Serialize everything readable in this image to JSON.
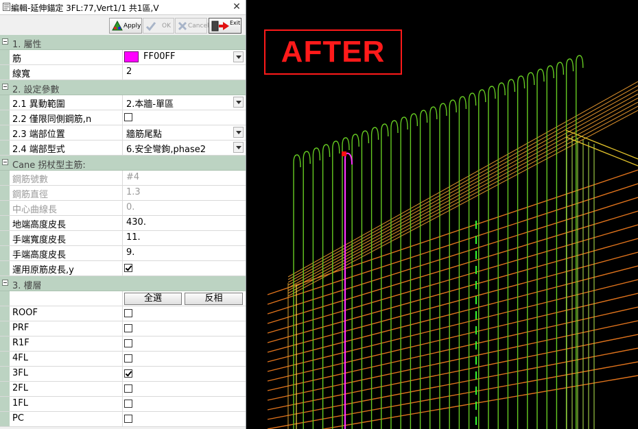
{
  "window": {
    "title": "編輯-延伸錨定 3FL:77,Vert1/1 共1區,V",
    "close_glyph": "✕"
  },
  "toolbar": {
    "apply": "Apply",
    "ok": "OK",
    "cancel": "Cancel",
    "exit": "Exit"
  },
  "sections": {
    "s1": "1. 屬性",
    "s2": "2. 設定參數",
    "s3": "Cane 拐杖型主筋:",
    "s4": "3. 樓層"
  },
  "props": {
    "rebar": {
      "name": "筋",
      "value": "FF00FF",
      "color": "#ff00ff"
    },
    "linewidth": {
      "name": "線寬",
      "value": "2"
    },
    "range": {
      "name": "2.1 異動範圍",
      "value": "2.本牆-單區"
    },
    "sameside": {
      "name": "2.2 僅限同側鋼筋,n",
      "checked": false
    },
    "endpos": {
      "name": "2.3 端部位置",
      "value": "牆筋尾點"
    },
    "endtype": {
      "name": "2.4 端部型式",
      "value": "6.安全彎鉤,phase2"
    },
    "barno": {
      "name": "鋼筋號數",
      "value": "#4"
    },
    "bardia": {
      "name": "鋼筋直徑",
      "value": "1.3"
    },
    "curve": {
      "name": "中心曲線長",
      "value": "0."
    },
    "ground": {
      "name": "地端高度皮長",
      "value": "430."
    },
    "handw": {
      "name": "手端寬度皮長",
      "value": "11."
    },
    "handh": {
      "name": "手端高度皮長",
      "value": "9."
    },
    "apply_orig": {
      "name": "運用原筋皮長,y",
      "checked": true
    }
  },
  "floors": {
    "select_all": "全選",
    "invert": "反相",
    "items": [
      {
        "name": "ROOF",
        "checked": false
      },
      {
        "name": "PRF",
        "checked": false
      },
      {
        "name": "R1F",
        "checked": false
      },
      {
        "name": "4FL",
        "checked": false
      },
      {
        "name": "3FL",
        "checked": true
      },
      {
        "name": "2FL",
        "checked": false
      },
      {
        "name": "1FL",
        "checked": false
      },
      {
        "name": "PC",
        "checked": false
      }
    ]
  },
  "viewport": {
    "badge": "AFTER",
    "colors": {
      "rebar_green": "#66cc22",
      "rebar_orange": "#e0731c",
      "highlight": "#ff33ff",
      "badge_red": "#ff1a1a"
    }
  }
}
